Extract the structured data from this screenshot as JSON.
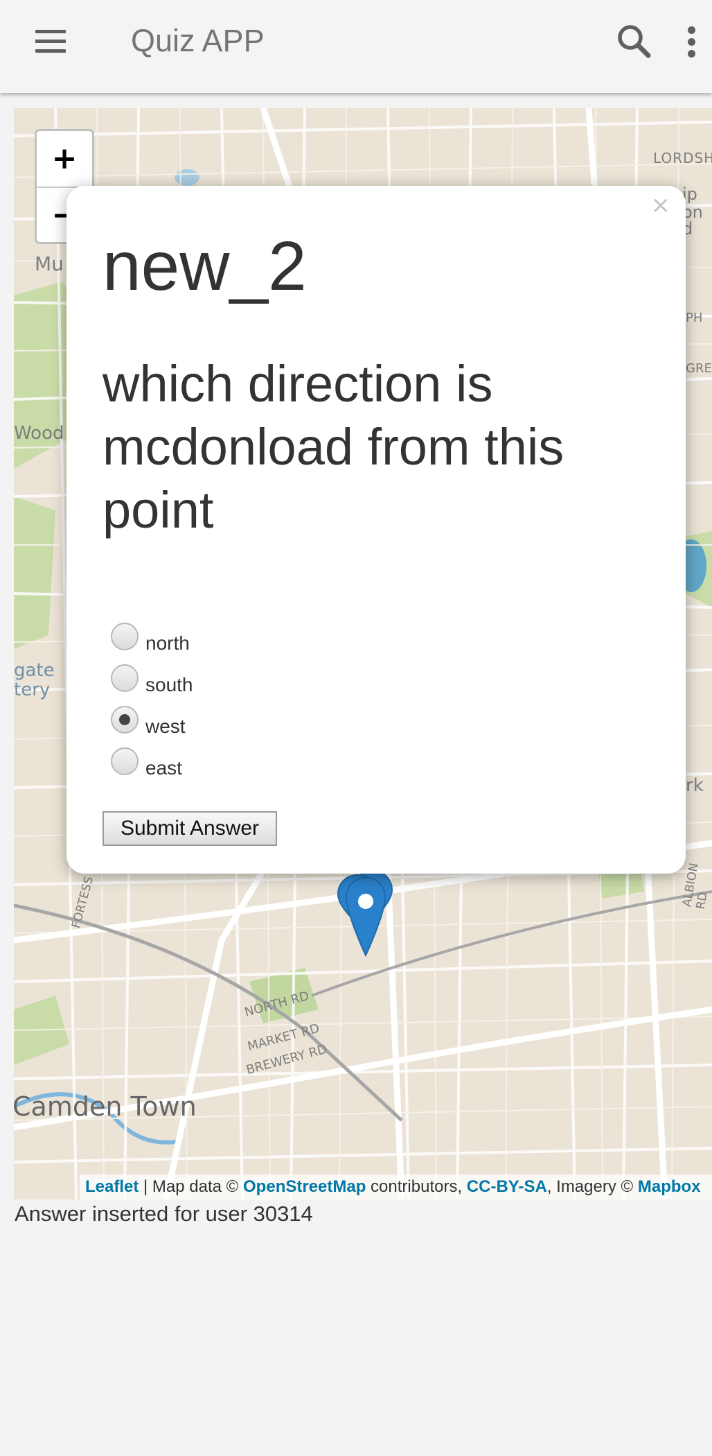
{
  "app_bar": {
    "title": "Quiz APP",
    "menu_icon": "hamburger-menu-icon",
    "search_icon": "search-icon",
    "more_icon": "more-vert-icon"
  },
  "map": {
    "zoom_in_label": "+",
    "zoom_out_label": "−",
    "place_labels": [
      "LORDSH",
      "ip",
      "on",
      "d",
      "Mu",
      "PH",
      "GRE",
      "Wood",
      "gate",
      "tery",
      "rk",
      "FORTESS R",
      "ALBION RD",
      "NORTH RD",
      "MARKET RD",
      "BREWERY RD",
      "Camden Town"
    ],
    "attribution": {
      "leaflet": "Leaflet",
      "sep1": " | Map data © ",
      "osm": "OpenStreetMap",
      "sep2": " contributors, ",
      "license": "CC-BY-SA",
      "sep3": ", Imagery © ",
      "imagery": "Mapbox"
    },
    "marker_icon": "map-marker-icon",
    "accent_color": "#2a81cb"
  },
  "popup": {
    "close_label": "×",
    "title": "new_2",
    "question": "which direction is mcdonload from this point",
    "options": [
      {
        "label": "north",
        "checked": false
      },
      {
        "label": "south",
        "checked": false
      },
      {
        "label": "west",
        "checked": true
      },
      {
        "label": "east",
        "checked": false
      }
    ],
    "submit_label": "Submit Answer"
  },
  "status_text": "Answer inserted for user 30314"
}
